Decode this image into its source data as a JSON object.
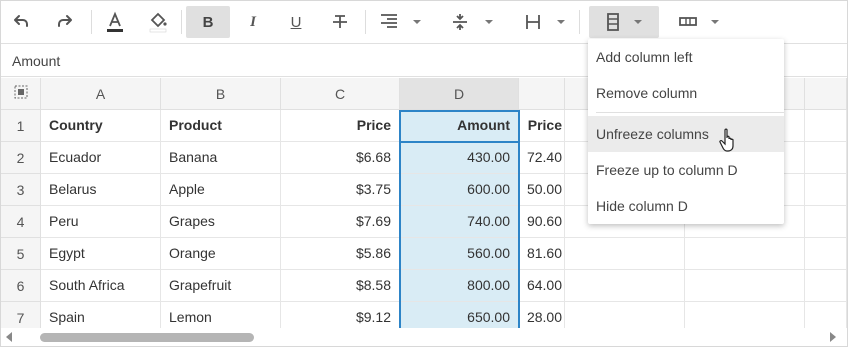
{
  "formula_bar": {
    "value": "Amount"
  },
  "toolbar": {
    "buttons": [
      {
        "name": "undo-icon"
      },
      {
        "name": "redo-icon"
      },
      {
        "name": "text-color-icon"
      },
      {
        "name": "fill-color-icon"
      },
      {
        "name": "bold-icon",
        "label": "B"
      },
      {
        "name": "italic-icon",
        "label": "I"
      },
      {
        "name": "underline-icon",
        "label": "U"
      },
      {
        "name": "strikethrough-icon"
      },
      {
        "name": "align-right-icon"
      },
      {
        "name": "vertical-align-icon"
      },
      {
        "name": "column-width-icon"
      },
      {
        "name": "freeze-column-icon"
      },
      {
        "name": "merge-cells-icon"
      }
    ],
    "bold_label": "B",
    "italic_label": "I",
    "underline_label": "U",
    "text_color": "#333333",
    "selected_accent": "#2d84c7"
  },
  "columns": {
    "A": "A",
    "B": "B",
    "C": "C",
    "D": "D"
  },
  "rows": [
    {
      "num": "1",
      "country": "Country",
      "product": "Product",
      "price": "Price",
      "amount": "Amount",
      "e": "Price"
    },
    {
      "num": "2",
      "country": "Ecuador",
      "product": "Banana",
      "price": "$6.68",
      "amount": "430.00",
      "e": "72.40"
    },
    {
      "num": "3",
      "country": "Belarus",
      "product": "Apple",
      "price": "$3.75",
      "amount": "600.00",
      "e": "50.00"
    },
    {
      "num": "4",
      "country": "Peru",
      "product": "Grapes",
      "price": "$7.69",
      "amount": "740.00",
      "e": "90.60"
    },
    {
      "num": "5",
      "country": "Egypt",
      "product": "Orange",
      "price": "$5.86",
      "amount": "560.00",
      "e": "81.60"
    },
    {
      "num": "6",
      "country": "South Africa",
      "product": "Grapefruit",
      "price": "$8.58",
      "amount": "800.00",
      "e": "64.00"
    },
    {
      "num": "7",
      "country": "Spain",
      "product": "Lemon",
      "price": "$9.12",
      "amount": "650.00",
      "e": "28.00"
    }
  ],
  "context_menu": {
    "items": [
      {
        "label": "Add column left"
      },
      {
        "label": "Remove column"
      },
      {
        "label": "Unfreeze columns"
      },
      {
        "label": "Freeze up to column D"
      },
      {
        "label": "Hide column D"
      }
    ]
  },
  "colors": {
    "selection_fill": "#d9ecf5",
    "selection_border": "#2d84c7",
    "header_bg": "#f5f5f5",
    "menu_hover": "#ebebeb"
  }
}
